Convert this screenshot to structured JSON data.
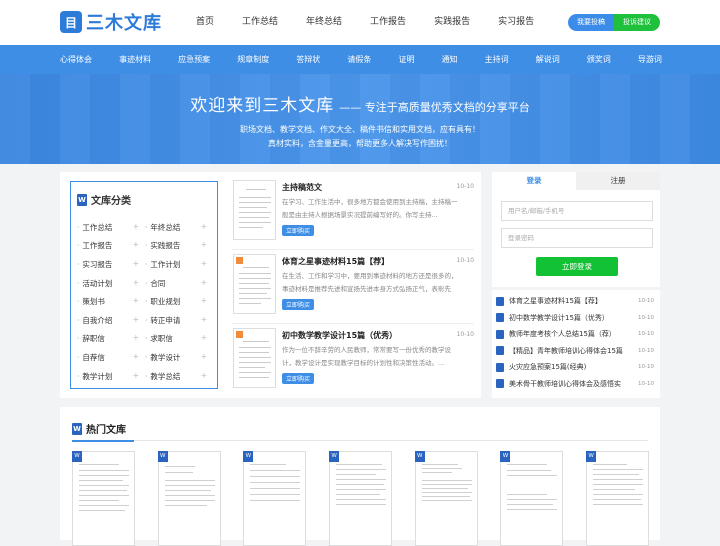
{
  "header": {
    "logo_text": "三木文库",
    "logo_glyph": "目",
    "nav": [
      "首页",
      "工作总结",
      "年终总结",
      "工作报告",
      "实践报告",
      "实习报告"
    ],
    "btn_report": "我要投稿",
    "btn_feedback": "投诉建议"
  },
  "catbar": [
    "心得体会",
    "事迹材料",
    "应急预案",
    "规章制度",
    "答辩状",
    "请假条",
    "证明",
    "通知",
    "主持词",
    "解说词",
    "颁奖词",
    "导游词"
  ],
  "banner": {
    "title_big": "欢迎来到三木文库",
    "title_small": "—— 专注于高质量优秀文档的分享平台",
    "sub1": "职场文档、教学文档、作文大全、稿件书信和实用文档，应有具有！",
    "sub2": "真材实料，含金量更高，帮助更多人解决写作困扰！"
  },
  "categories": {
    "title": "文库分类",
    "w_glyph": "W",
    "dot": "·",
    "plus": "+",
    "items": [
      [
        "工作总结",
        "年终总结"
      ],
      [
        "工作报告",
        "实践报告"
      ],
      [
        "实习报告",
        "工作计划"
      ],
      [
        "活动计划",
        "合同"
      ],
      [
        "策划书",
        "职业规划"
      ],
      [
        "自我介绍",
        "转正申请"
      ],
      [
        "辞职信",
        "求职信"
      ],
      [
        "自荐信",
        "教学设计"
      ],
      [
        "教学计划",
        "教学总结"
      ]
    ]
  },
  "docs": [
    {
      "title": "主持稿范文",
      "date": "10-10",
      "desc": "在学习、工作生活中，很多地方都会使用到主持稿，主持稿一般是由主持人根据场景实况提前编写好的。你写主持...",
      "btn": "立即购买"
    },
    {
      "title": "体育之星事迹材料15篇【荐】",
      "date": "10-10",
      "desc": "在生活、工作和学习中，要用到事迹材料的地方还是很多的，事迹材料是推荐先进和宣扬先进本身方式弘扬正气，表彰先进，...",
      "btn": "立即购买"
    },
    {
      "title": "初中数学教学设计15篇（优秀）",
      "date": "10-10",
      "desc": "作为一位不辞辛劳的人民教师，常常要写一份优秀的教学设计，教学设计是实现教学目标的计划性和决策性活动。...",
      "btn": "立即购买"
    }
  ],
  "login": {
    "tab_login": "登录",
    "tab_register": "注册",
    "user_placeholder": "用户名/邮箱/手机号",
    "pass_placeholder": "登录密码",
    "btn": "立即登录"
  },
  "doc_list": [
    {
      "title": "体育之星事迹材料15篇【荐】",
      "date": "10-10"
    },
    {
      "title": "初中数学教学设计15篇（优秀）",
      "date": "10-10"
    },
    {
      "title": "教师年度考核个人总结15篇（荐）",
      "date": "10-10"
    },
    {
      "title": "【精品】青年教师培训心得体会15篇",
      "date": "10-10"
    },
    {
      "title": "火灾应急预案15篇(经典)",
      "date": "10-10"
    },
    {
      "title": "美术骨干教师培训心得体会及感悟实",
      "date": "10-10"
    }
  ],
  "hot": {
    "title": "热门文库",
    "count": 7
  },
  "colors": {
    "brand": "#2d7bd8",
    "bar": "#3f8ee6",
    "green": "#12c234"
  }
}
